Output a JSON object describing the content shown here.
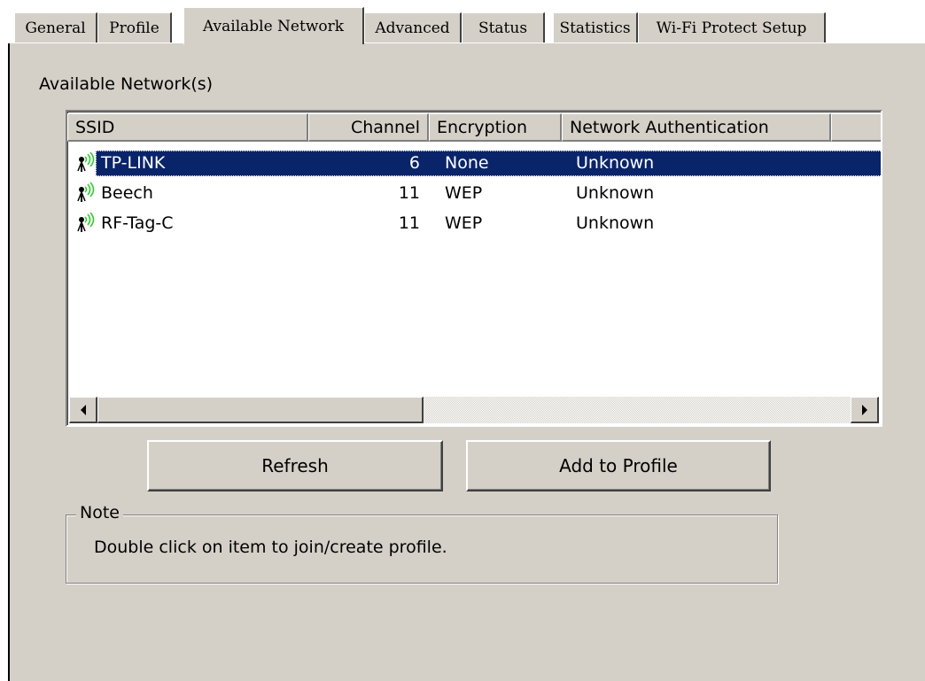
{
  "tabs": [
    {
      "label": "General",
      "active": false
    },
    {
      "label": "Profile",
      "active": false
    },
    {
      "label": "Available Network",
      "active": true
    },
    {
      "label": "Advanced",
      "active": false
    },
    {
      "label": "Status",
      "active": false
    },
    {
      "label": "Statistics",
      "active": false
    },
    {
      "label": "Wi-Fi Protect Setup",
      "active": false
    }
  ],
  "section_label": "Available Network(s)",
  "table": {
    "columns": [
      "SSID",
      "Channel",
      "Encryption",
      "Network Authentication"
    ],
    "rows": [
      {
        "ssid": "TP-LINK",
        "channel": "6",
        "encryption": "None",
        "auth": "Unknown",
        "selected": true
      },
      {
        "ssid": "Beech",
        "channel": "11",
        "encryption": "WEP",
        "auth": "Unknown",
        "selected": false
      },
      {
        "ssid": "RF-Tag-C",
        "channel": "11",
        "encryption": "WEP",
        "auth": "Unknown",
        "selected": false
      }
    ],
    "row_icon": "wifi-signal-icon"
  },
  "buttons": {
    "refresh": "Refresh",
    "add_to_profile": "Add to Profile"
  },
  "note": {
    "legend": "Note",
    "text": "Double click on item to join/create profile."
  },
  "colors": {
    "face": "#d4d0c8",
    "selection": "#0a246a",
    "signal_green": "#33cc33"
  }
}
